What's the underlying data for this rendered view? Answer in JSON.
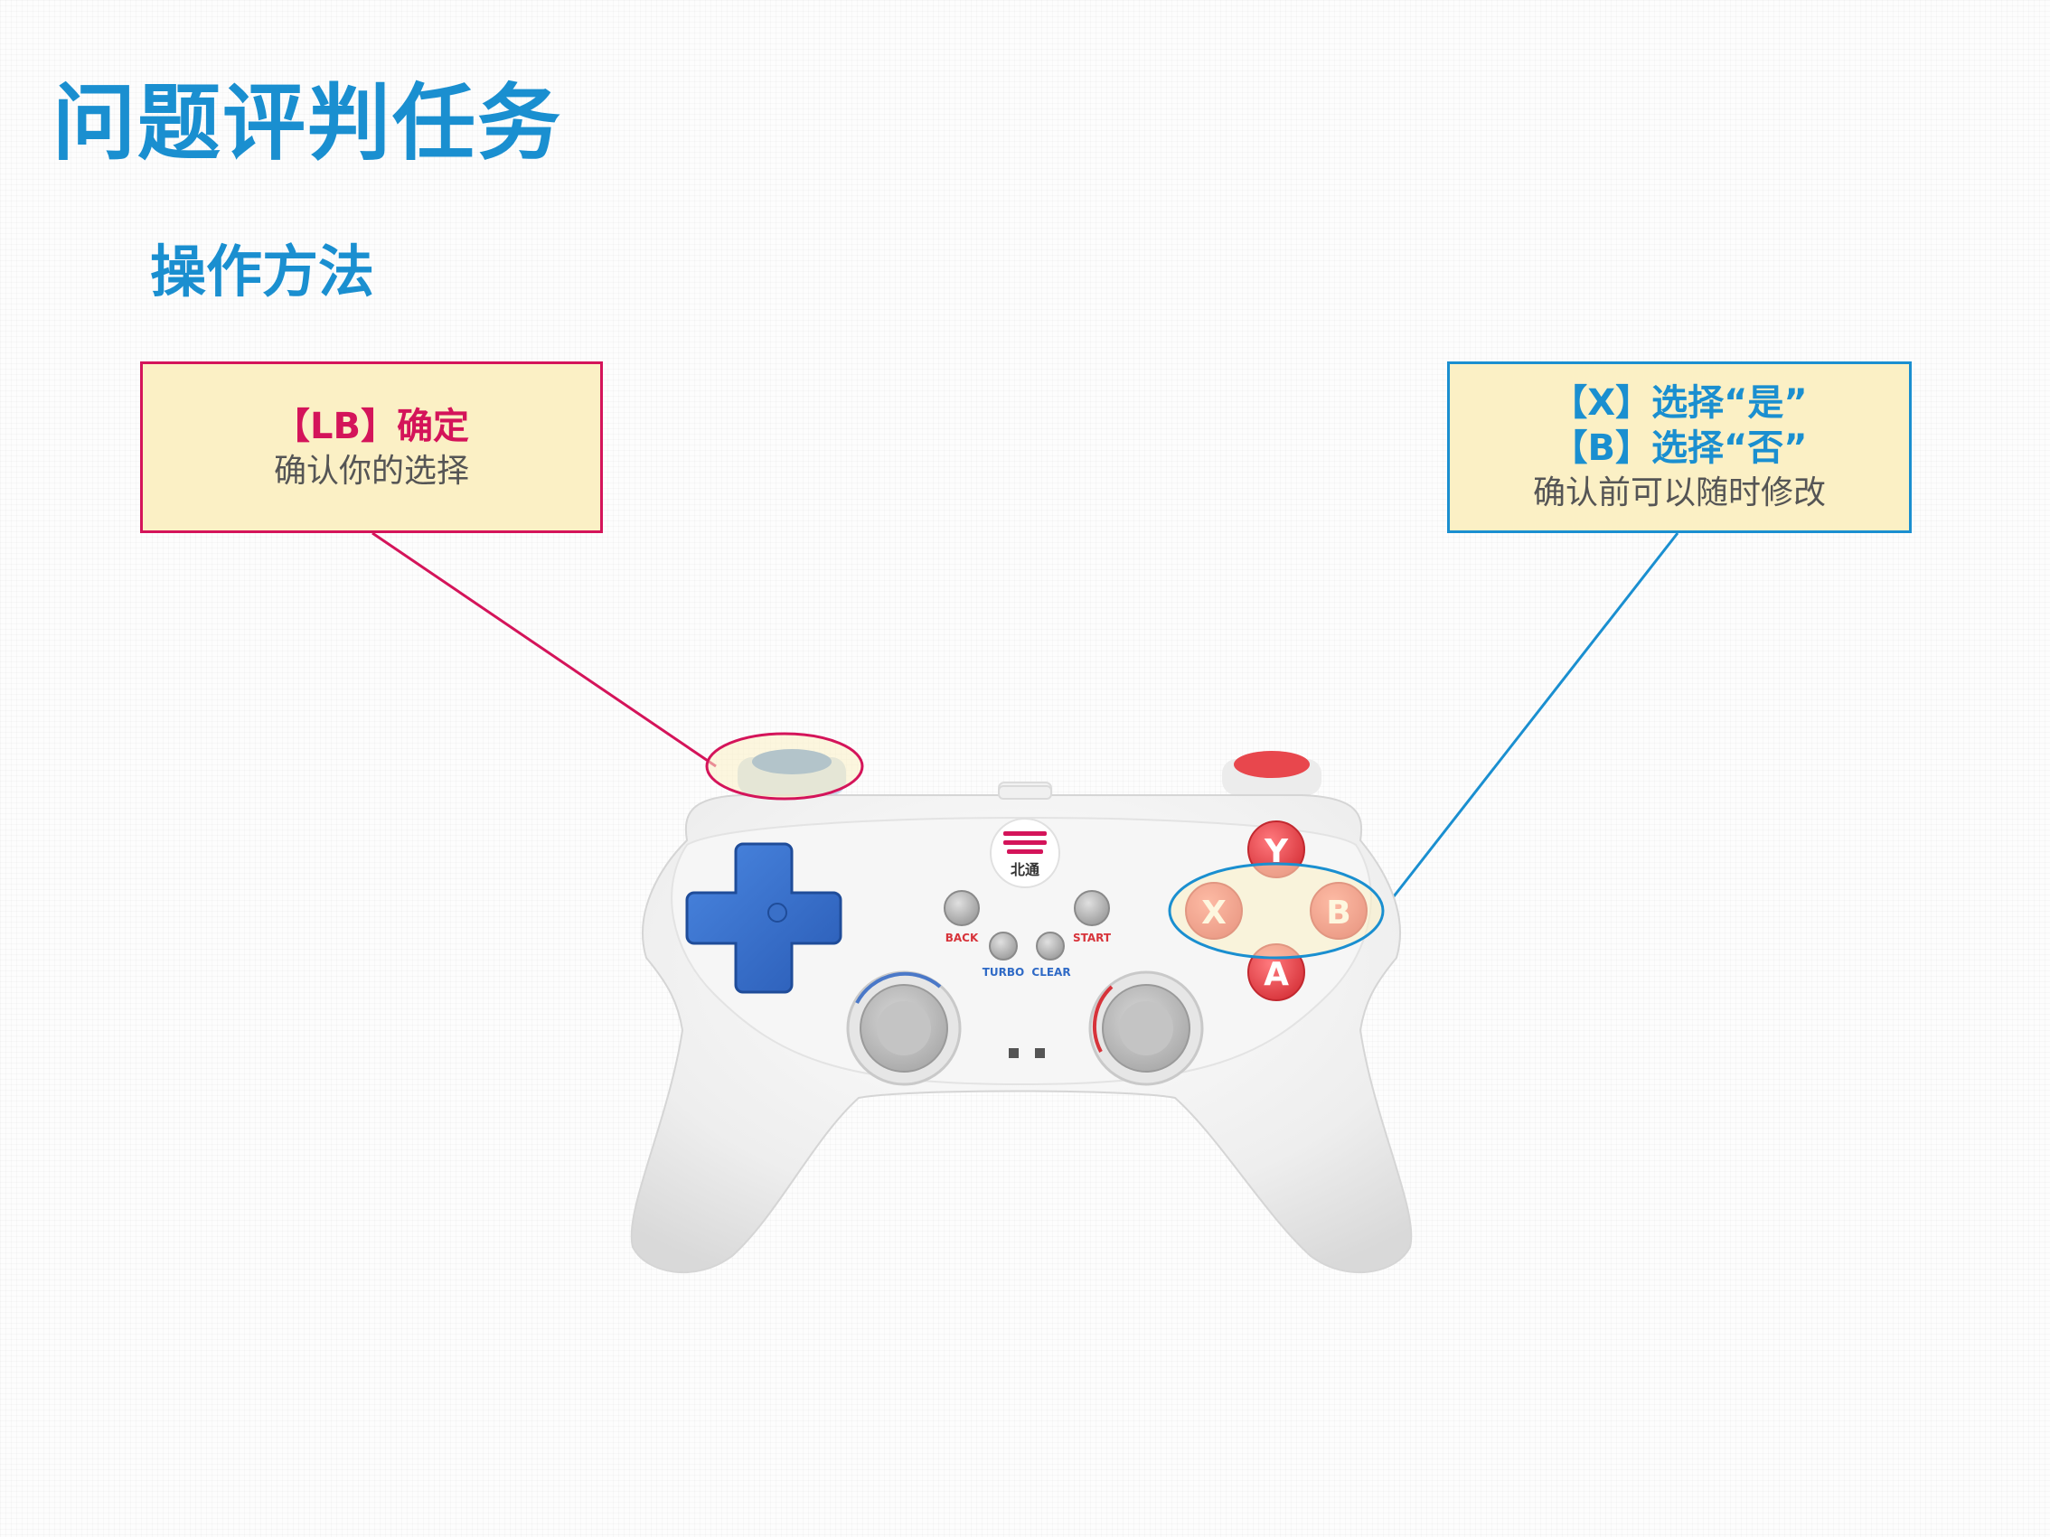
{
  "page": {
    "title": "问题评判任务",
    "subtitle": "操作方法"
  },
  "callouts": {
    "lb": {
      "heading": "【LB】确定",
      "description": "确认你的选择"
    },
    "xb": {
      "line1": "【X】选择“是”",
      "line2": "【B】选择“否”",
      "description": "确认前可以随时修改"
    }
  },
  "controller": {
    "logo_text": "北通",
    "buttons": {
      "y": "Y",
      "x": "X",
      "b": "B",
      "a": "A",
      "back": "BACK",
      "start": "START",
      "turbo": "TURBO",
      "clear": "CLEAR"
    }
  },
  "colors": {
    "title_blue": "#1a8fd0",
    "accent_magenta": "#d4145a",
    "callout_fill": "#fbf0c5",
    "face_button_red": "#e8474d",
    "dpad_blue": "#2f6ac6"
  }
}
